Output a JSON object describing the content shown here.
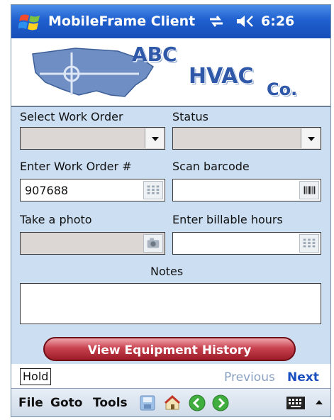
{
  "titlebar": {
    "app_title": "MobileFrame Client",
    "time": "6:26"
  },
  "banner": {
    "logo_line1": "ABC",
    "logo_line2": "HVAC",
    "logo_line3": "Co."
  },
  "form": {
    "select_work_order_label": "Select Work Order",
    "select_work_order_value": "",
    "status_label": "Status",
    "status_value": "",
    "enter_work_order_label": "Enter Work Order #",
    "enter_work_order_value": "907688",
    "scan_barcode_label": "Scan barcode",
    "scan_barcode_value": "",
    "take_photo_label": "Take a photo",
    "billable_hours_label": "Enter billable hours",
    "billable_hours_value": "",
    "notes_label": "Notes",
    "notes_value": ""
  },
  "actions": {
    "view_history_label": "View Equipment History",
    "hold_label": "Hold",
    "previous_label": "Previous",
    "next_label": "Next"
  },
  "menubar": {
    "items": [
      "File",
      "Goto",
      "Tools"
    ],
    "icons": [
      "save-icon",
      "home-icon",
      "back-arrow-icon",
      "forward-arrow-icon",
      "keyboard-icon",
      "up-arrow-icon"
    ]
  }
}
